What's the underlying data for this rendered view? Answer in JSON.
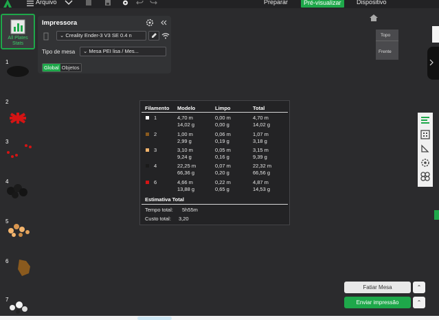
{
  "topbar": {
    "arquivo": "Arquivo",
    "tabs": [
      "Preparar",
      "Pré-visualizar",
      "Dispositivo"
    ],
    "active_tab": "Pré-visualizar"
  },
  "plates": {
    "all_label": "All Plates Stats",
    "numbers": [
      "1",
      "2",
      "3",
      "4",
      "5",
      "6",
      "7"
    ]
  },
  "printer": {
    "title": "Impressora",
    "printer_select": "Creality Ender-3 V3 SE 0.4 n",
    "bed_label": "Tipo de mesa",
    "bed_select": "Mesa PEI lisa / Mes...",
    "seg_global": "Global",
    "seg_objetos": "Objetos"
  },
  "stats": {
    "headers": [
      "Filamento",
      "Modelo",
      "Limpo",
      "Total"
    ],
    "rows": [
      {
        "num": "1",
        "color": "#ffffff",
        "modelo_m": "4,70 m",
        "modelo_g": "14,02 g",
        "limpo_m": "0,00 m",
        "limpo_g": "0,00 g",
        "total_m": "4,70 m",
        "total_g": "14,02 g"
      },
      {
        "num": "2",
        "color": "#8a5a1e",
        "modelo_m": "1,00 m",
        "modelo_g": "2,99 g",
        "limpo_m": "0,06 m",
        "limpo_g": "0,19 g",
        "total_m": "1,07 m",
        "total_g": "3,18 g"
      },
      {
        "num": "3",
        "color": "#f3b46c",
        "modelo_m": "3,10 m",
        "modelo_g": "9,24 g",
        "limpo_m": "0,05 m",
        "limpo_g": "0,16 g",
        "total_m": "3,15 m",
        "total_g": "9,39 g"
      },
      {
        "num": "4",
        "color": "#1a1a1a",
        "modelo_m": "22,25 m",
        "modelo_g": "66,36 g",
        "limpo_m": "0,07 m",
        "limpo_g": "0,20 g",
        "total_m": "22,32 m",
        "total_g": "66,56 g"
      },
      {
        "num": "6",
        "color": "#d41414",
        "modelo_m": "4,66 m",
        "modelo_g": "13,88 g",
        "limpo_m": "0,22 m",
        "limpo_g": "0,65 g",
        "total_m": "4,87 m",
        "total_g": "14,53 g"
      }
    ],
    "estimate_title": "Estimativa Total",
    "time_label": "Tempo total:",
    "time_value": "5h55m",
    "cost_label": "Custo total:",
    "cost_value": "3,20"
  },
  "viewcube": {
    "top": "Topo",
    "front": "Frente"
  },
  "actions": {
    "slice": "Fatiar Mesa",
    "send": "Enviar impressão"
  }
}
